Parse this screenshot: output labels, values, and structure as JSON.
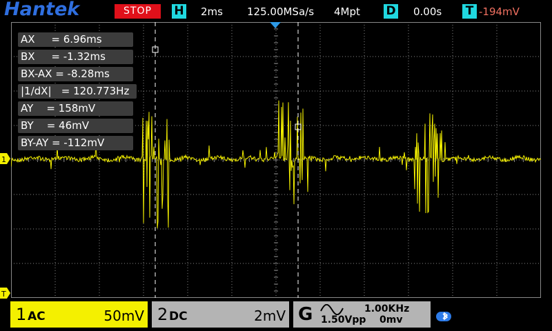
{
  "top_bar": {
    "logo": "Hantek",
    "run_state": "STOP",
    "horizontal_tag": "H",
    "timebase": "2ms",
    "sample_rate": "125.00MSa/s",
    "memory_depth": "4Mpt",
    "delay_tag": "D",
    "delay": "0.00s",
    "trigger_tag": "T",
    "trigger_level": "-194mV",
    "colors": {
      "stop_bg": "#e0101a",
      "tag_bg": "#20d8e0",
      "logo": "#2f6fe0",
      "trigger": "#f07060"
    }
  },
  "measurements": [
    {
      "label": "AX     = 6.96ms"
    },
    {
      "label": "BX     = -1.32ms"
    },
    {
      "label": "BX-AX = -8.28ms"
    },
    {
      "label": "|1/dX|   = 120.773Hz"
    },
    {
      "label": "AY    = 158mV"
    },
    {
      "label": "BY    = 46mV"
    },
    {
      "label": "BY-AY = -112mV"
    }
  ],
  "screen": {
    "channel1_marker": "1",
    "trigger_marker": "T",
    "trace_color": "#f4f000"
  },
  "bottom_bar": {
    "ch1": {
      "number": "1",
      "coupling": "AC",
      "scale": "50mV",
      "color": "#f4f000"
    },
    "ch2": {
      "number": "2",
      "coupling": "DC",
      "scale": "2mV",
      "color": "#b4b4b4"
    },
    "generator": {
      "label": "G",
      "waveform_icon": "sine-wave-icon",
      "frequency": "1.00KHz",
      "amplitude": "1.50Vpp",
      "offset": "0mv"
    },
    "status_icon": "bluetooth-icon"
  }
}
